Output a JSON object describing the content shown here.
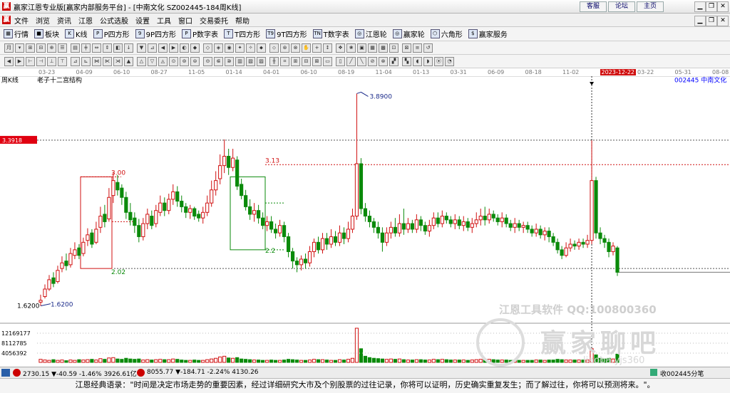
{
  "window": {
    "logo_char": "赢",
    "title": "赢家江恩专业版[赢家内部服务平台] - [中南文化  SZ002445-184周K线]",
    "links": [
      "客服",
      "论坛",
      "主页"
    ]
  },
  "menu": {
    "logo_char": "赢",
    "items": [
      "文件",
      "浏览",
      "资讯",
      "江恩",
      "公式选股",
      "设置",
      "工具",
      "窗口",
      "交易委托",
      "帮助"
    ]
  },
  "toolbar": {
    "buttons": [
      {
        "icon": "grid-icon",
        "glyph": "▦",
        "label": "行情"
      },
      {
        "icon": "block-icon",
        "glyph": "■",
        "label": "板块"
      },
      {
        "icon": "kline-icon",
        "glyph": "K",
        "label": "K线"
      },
      {
        "icon": "square-icon",
        "glyph": "P",
        "label": "P四方形"
      },
      {
        "icon": "square9-icon",
        "glyph": "9",
        "label": "9P四方形"
      },
      {
        "icon": "numtable-icon",
        "glyph": "P",
        "label": "P数字表"
      },
      {
        "icon": "tsquare-icon",
        "glyph": "T",
        "label": "T四方形"
      },
      {
        "icon": "t9square-icon",
        "glyph": "T9",
        "label": "9T四方形"
      },
      {
        "icon": "tnum-icon",
        "glyph": "TN",
        "label": "T数字表"
      },
      {
        "icon": "wheel-icon",
        "glyph": "◎",
        "label": "江恩轮"
      },
      {
        "icon": "wheel2-icon",
        "glyph": "◎",
        "label": "赢家轮"
      },
      {
        "icon": "hexagon-icon",
        "glyph": "⬡",
        "label": "六角形"
      },
      {
        "icon": "dollar-icon",
        "glyph": "$",
        "label": "赢家服务"
      }
    ]
  },
  "top_axis_labels": [
    "03-23",
    "04-09",
    "06-10",
    "08-27",
    "11-05",
    "01-14",
    "04-01",
    "06-10",
    "08-19",
    "11-04",
    "01-13",
    "03-31",
    "06-09",
    "08-18",
    "11-02",
    "2023-12-22",
    "03-22",
    "05-31",
    "08-08"
  ],
  "chart": {
    "period_label": "周K线",
    "subtitle": "老子十二宫结构",
    "stock_code_name": "002445  中南文化",
    "left_price_box": "3.3918",
    "cursor_date": "2023-12-22",
    "annotations": {
      "high": "3.8900",
      "low_left": "1.6200",
      "low_arrow": "1.6200",
      "box1_top": "3.00",
      "box1_bottom": "2.02",
      "box2_top": "3.13",
      "box2_bottom": "2.2"
    },
    "volume_ticks": [
      "12169177",
      "8112785",
      "4056392"
    ],
    "up_color": "#d01010",
    "down_color": "#0a8a0a"
  },
  "chart_data": {
    "type": "candlestick",
    "title": "老子十二宫结构",
    "ylim": [
      1.45,
      4.0
    ],
    "candles": [
      [
        1.66,
        1.68,
        1.62,
        1.74
      ],
      [
        1.72,
        1.8,
        1.7,
        1.85
      ],
      [
        1.8,
        1.9,
        1.78,
        1.95
      ],
      [
        1.92,
        1.86,
        1.82,
        1.98
      ],
      [
        1.88,
        2.0,
        1.86,
        2.05
      ],
      [
        2.02,
        2.08,
        1.98,
        2.15
      ],
      [
        2.1,
        2.05,
        2.0,
        2.18
      ],
      [
        2.06,
        2.18,
        2.03,
        2.24
      ],
      [
        2.16,
        2.22,
        2.12,
        2.3
      ],
      [
        2.24,
        2.16,
        2.12,
        2.28
      ],
      [
        2.18,
        2.3,
        2.15,
        2.35
      ],
      [
        2.32,
        2.38,
        2.26,
        2.45
      ],
      [
        2.4,
        2.28,
        2.24,
        2.44
      ],
      [
        2.3,
        2.44,
        2.28,
        2.52
      ],
      [
        2.46,
        2.58,
        2.4,
        2.68
      ],
      [
        2.6,
        2.52,
        2.46,
        2.7
      ],
      [
        2.55,
        2.78,
        2.52,
        2.88
      ],
      [
        2.8,
        2.96,
        2.72,
        3.05
      ],
      [
        2.94,
        2.86,
        2.8,
        3.02
      ],
      [
        2.88,
        2.78,
        2.7,
        2.92
      ],
      [
        2.78,
        2.62,
        2.55,
        2.84
      ],
      [
        2.62,
        2.54,
        2.48,
        2.72
      ],
      [
        2.56,
        2.48,
        2.4,
        2.62
      ],
      [
        2.48,
        2.36,
        2.3,
        2.55
      ],
      [
        2.36,
        2.5,
        2.32,
        2.56
      ],
      [
        2.5,
        2.6,
        2.44,
        2.66
      ],
      [
        2.58,
        2.48,
        2.44,
        2.64
      ],
      [
        2.5,
        2.64,
        2.46,
        2.7
      ],
      [
        2.62,
        2.72,
        2.58,
        2.8
      ],
      [
        2.72,
        2.64,
        2.58,
        2.78
      ],
      [
        2.64,
        2.76,
        2.6,
        2.82
      ],
      [
        2.76,
        2.84,
        2.7,
        2.92
      ],
      [
        2.84,
        2.74,
        2.68,
        2.9
      ],
      [
        2.74,
        2.68,
        2.62,
        2.8
      ],
      [
        2.68,
        2.62,
        2.56,
        2.72
      ],
      [
        2.62,
        2.66,
        2.55,
        2.7
      ],
      [
        2.66,
        2.58,
        2.54,
        2.68
      ],
      [
        2.6,
        2.56,
        2.52,
        2.64
      ],
      [
        2.56,
        2.62,
        2.5,
        2.68
      ],
      [
        2.62,
        2.72,
        2.58,
        2.8
      ],
      [
        2.72,
        2.86,
        2.68,
        2.96
      ],
      [
        2.86,
        2.96,
        2.8,
        3.06
      ],
      [
        2.98,
        3.12,
        2.92,
        3.24
      ],
      [
        3.12,
        3.22,
        3.04,
        3.4
      ],
      [
        3.22,
        3.1,
        3.02,
        3.3
      ],
      [
        3.1,
        3.2,
        3.06,
        3.3
      ],
      [
        3.18,
        2.9,
        2.86,
        3.22
      ],
      [
        2.92,
        2.8,
        2.76,
        2.98
      ],
      [
        2.8,
        2.68,
        2.64,
        2.86
      ],
      [
        2.68,
        2.6,
        2.54,
        2.76
      ],
      [
        2.6,
        2.64,
        2.52,
        2.72
      ],
      [
        2.64,
        2.56,
        2.5,
        2.7
      ],
      [
        2.56,
        2.48,
        2.44,
        2.62
      ],
      [
        2.48,
        2.52,
        2.42,
        2.58
      ],
      [
        2.52,
        2.44,
        2.4,
        2.58
      ],
      [
        2.44,
        2.4,
        2.34,
        2.5
      ],
      [
        2.4,
        2.48,
        2.36,
        2.54
      ],
      [
        2.48,
        2.36,
        2.3,
        2.52
      ],
      [
        2.36,
        2.2,
        2.14,
        2.4
      ],
      [
        2.2,
        2.1,
        2.02,
        2.24
      ],
      [
        2.1,
        2.06,
        1.98,
        2.14
      ],
      [
        2.06,
        2.12,
        2.0,
        2.16
      ],
      [
        2.12,
        2.08,
        2.02,
        2.18
      ],
      [
        2.08,
        2.2,
        2.04,
        2.26
      ],
      [
        2.2,
        2.3,
        2.14,
        2.34
      ],
      [
        2.3,
        2.22,
        2.18,
        2.36
      ],
      [
        2.22,
        2.34,
        2.18,
        2.4
      ],
      [
        2.34,
        2.28,
        2.22,
        2.4
      ],
      [
        2.28,
        2.36,
        2.24,
        2.44
      ],
      [
        2.36,
        2.3,
        2.26,
        2.42
      ],
      [
        2.3,
        2.4,
        2.26,
        2.48
      ],
      [
        2.4,
        2.34,
        2.28,
        2.46
      ],
      [
        2.34,
        2.44,
        2.3,
        2.52
      ],
      [
        2.44,
        2.58,
        2.4,
        2.66
      ],
      [
        2.58,
        3.14,
        2.54,
        3.89
      ],
      [
        3.14,
        2.66,
        2.6,
        3.2
      ],
      [
        2.66,
        2.58,
        2.52,
        2.72
      ],
      [
        2.58,
        2.52,
        2.46,
        2.64
      ],
      [
        2.52,
        2.46,
        2.4,
        2.56
      ],
      [
        2.46,
        2.4,
        2.34,
        2.52
      ],
      [
        2.4,
        2.3,
        2.2,
        2.46
      ],
      [
        2.3,
        2.4,
        2.26,
        2.46
      ],
      [
        2.4,
        2.46,
        2.34,
        2.52
      ],
      [
        2.46,
        2.4,
        2.36,
        2.56
      ],
      [
        2.4,
        2.5,
        2.36,
        2.6
      ],
      [
        2.5,
        2.44,
        2.38,
        2.66
      ],
      [
        2.44,
        2.5,
        2.4,
        2.56
      ],
      [
        2.5,
        2.44,
        2.4,
        2.54
      ],
      [
        2.44,
        2.54,
        2.4,
        2.6
      ],
      [
        2.54,
        2.48,
        2.42,
        2.58
      ],
      [
        2.48,
        2.42,
        2.38,
        2.52
      ],
      [
        2.42,
        2.48,
        2.36,
        2.54
      ],
      [
        2.48,
        2.56,
        2.44,
        2.62
      ],
      [
        2.56,
        2.5,
        2.46,
        2.62
      ],
      [
        2.5,
        2.58,
        2.46,
        2.64
      ],
      [
        2.58,
        2.54,
        2.5,
        2.62
      ],
      [
        2.54,
        2.5,
        2.46,
        2.58
      ],
      [
        2.5,
        2.54,
        2.44,
        2.6
      ],
      [
        2.54,
        2.48,
        2.44,
        2.58
      ],
      [
        2.48,
        2.52,
        2.42,
        2.58
      ],
      [
        2.52,
        2.46,
        2.42,
        2.56
      ],
      [
        2.46,
        2.5,
        2.4,
        2.56
      ],
      [
        2.5,
        2.54,
        2.46,
        2.62
      ],
      [
        2.54,
        2.58,
        2.48,
        2.66
      ],
      [
        2.58,
        2.54,
        2.48,
        2.68
      ],
      [
        2.54,
        2.6,
        2.5,
        2.66
      ],
      [
        2.6,
        2.56,
        2.52,
        2.64
      ],
      [
        2.56,
        2.52,
        2.48,
        2.6
      ],
      [
        2.52,
        2.56,
        2.46,
        2.62
      ],
      [
        2.56,
        2.5,
        2.46,
        2.6
      ],
      [
        2.5,
        2.46,
        2.42,
        2.54
      ],
      [
        2.46,
        2.5,
        2.4,
        2.56
      ],
      [
        2.5,
        2.46,
        2.42,
        2.54
      ],
      [
        2.46,
        2.48,
        2.4,
        2.52
      ],
      [
        2.48,
        2.44,
        2.4,
        2.52
      ],
      [
        2.44,
        2.4,
        2.36,
        2.48
      ],
      [
        2.4,
        2.44,
        2.36,
        2.5
      ],
      [
        2.44,
        2.38,
        2.34,
        2.48
      ],
      [
        2.38,
        2.42,
        2.32,
        2.46
      ],
      [
        2.42,
        2.36,
        2.3,
        2.46
      ],
      [
        2.36,
        2.3,
        2.26,
        2.4
      ],
      [
        2.3,
        2.22,
        2.18,
        2.34
      ],
      [
        2.22,
        2.16,
        2.12,
        2.26
      ],
      [
        2.16,
        2.24,
        2.14,
        2.3
      ],
      [
        2.24,
        2.28,
        2.2,
        2.34
      ],
      [
        2.28,
        2.26,
        2.22,
        2.32
      ],
      [
        2.26,
        2.3,
        2.22,
        2.34
      ],
      [
        2.3,
        2.28,
        2.24,
        2.34
      ],
      [
        2.28,
        2.32,
        2.24,
        2.38
      ],
      [
        2.32,
        2.96,
        2.28,
        3.39
      ],
      [
        2.96,
        2.4,
        2.34,
        3.0
      ],
      [
        2.4,
        2.34,
        2.28,
        2.46
      ],
      [
        2.34,
        2.3,
        2.24,
        2.38
      ],
      [
        2.3,
        2.2,
        2.14,
        2.34
      ],
      [
        2.2,
        2.26,
        2.16,
        2.3
      ],
      [
        2.24,
        1.98,
        1.94,
        2.26
      ]
    ],
    "volumes": [
      9,
      7,
      6,
      8,
      6,
      7,
      5,
      7,
      6,
      8,
      7,
      8,
      9,
      7,
      11,
      9,
      13,
      14,
      10,
      9,
      12,
      10,
      9,
      10,
      7,
      8,
      7,
      8,
      9,
      8,
      8,
      10,
      9,
      7,
      6,
      6,
      7,
      6,
      6,
      8,
      10,
      12,
      16,
      18,
      13,
      12,
      14,
      10,
      9,
      8,
      7,
      7,
      6,
      6,
      7,
      6,
      6,
      7,
      9,
      8,
      7,
      6,
      6,
      7,
      9,
      8,
      8,
      7,
      6,
      6,
      8,
      7,
      9,
      12,
      100,
      40,
      18,
      14,
      12,
      11,
      10,
      9,
      10,
      9,
      10,
      8,
      7,
      7,
      8,
      8,
      7,
      7,
      9,
      8,
      9,
      8,
      7,
      7,
      7,
      7,
      6,
      7,
      8,
      9,
      8,
      9,
      8,
      7,
      7,
      7,
      6,
      7,
      6,
      6,
      6,
      6,
      7,
      7,
      6,
      7,
      7,
      9,
      8,
      7,
      7,
      7,
      7,
      7,
      7,
      40,
      22,
      12,
      10,
      12,
      10,
      24
    ]
  },
  "status": {
    "index1": "2730.15 ▼-40.59 -1.46% 3926.61亿",
    "index2": "8055.77 ▼-184.71 -2.24% 4130.26",
    "right": "收002445分笔"
  },
  "quote": "江恩经典语录：\"时间是决定市场走势的重要因素，经过详细研究大市及个别股票的过往记录，你将可以证明，历史确实重复发生；而了解过往，你将可以预测将来。\"。",
  "watermark": {
    "line1": "江恩工具软件  QQ:100800360",
    "line2": "赢家聊吧",
    "line3": "liaoba.yjs360"
  }
}
